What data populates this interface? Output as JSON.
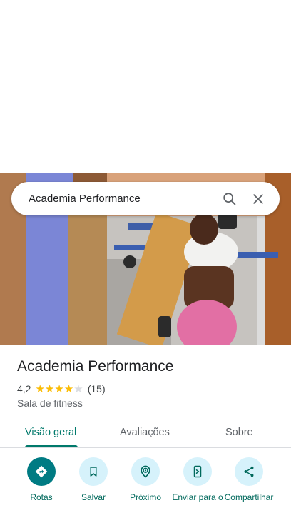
{
  "search": {
    "query": "Academia Performance"
  },
  "icons": {
    "search": "search-icon",
    "close": "close-icon",
    "directions": "directions-icon",
    "save": "bookmark-icon",
    "nearby": "nearby-icon",
    "send": "send-to-phone-icon",
    "share": "share-icon"
  },
  "place": {
    "title": "Academia Performance",
    "rating": "4,2",
    "stars_filled": 4,
    "reviews": "(15)",
    "category": "Sala de fitness"
  },
  "tabs": [
    {
      "label": "Visão geral",
      "active": true
    },
    {
      "label": "Avaliações",
      "active": false
    },
    {
      "label": "Sobre",
      "active": false
    }
  ],
  "actions": [
    {
      "label": "Rotas"
    },
    {
      "label": "Salvar"
    },
    {
      "label": "Próximo"
    },
    {
      "label": "Enviar para o"
    },
    {
      "label": "Compartilhar"
    }
  ],
  "colors": {
    "accent": "#00796b",
    "primary_button": "#007b83",
    "chip_bg": "#d6f2fb",
    "star": "#fbbc04",
    "star_empty": "#dadce0"
  }
}
